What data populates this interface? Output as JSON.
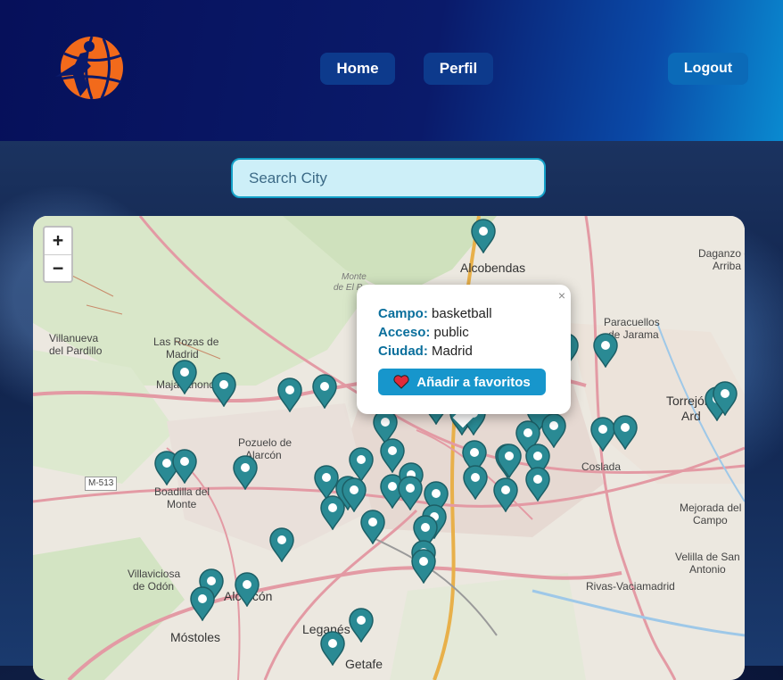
{
  "nav": {
    "home": "Home",
    "perfil": "Perfil",
    "logout": "Logout"
  },
  "search": {
    "placeholder": "Search City"
  },
  "zoom": {
    "in": "+",
    "out": "−"
  },
  "popup": {
    "close": "×",
    "campo_label": "Campo:",
    "campo_value": "basketball",
    "acceso_label": "Acceso:",
    "acceso_value": "public",
    "ciudad_label": "Ciudad:",
    "ciudad_value": "Madrid",
    "fav_button": "Añadir a favoritos"
  },
  "map_labels": {
    "alcobendas": "Alcobendas",
    "monte1": "Monte",
    "monte2": "de El P",
    "dagan1": "Daganzo d",
    "dagan2": "Arriba",
    "paracuellos1": "Paracuellos",
    "paracuellos2": "de Jarama",
    "villanueva1": "Villanueva",
    "villanueva2": "del Pardillo",
    "rozas1": "Las Rozas de",
    "rozas2": "Madrid",
    "majadahonda": "Majadahonda",
    "torrejon1": "Torrejón",
    "torrejon2": "Ard",
    "pozuelo1": "Pozuelo de",
    "pozuelo2": "Alarcón",
    "coslada": "Coslada",
    "boadilla1": "Boadilla del",
    "boadilla2": "Monte",
    "m513": "M-513",
    "mejorada1": "Mejorada del",
    "mejorada2": "Campo",
    "villaviciosa1": "Villaviciosa",
    "villaviciosa2": "de Odón",
    "velilla1": "Velilla de San",
    "velilla2": "Antonio",
    "rivas": "Rivas-Vaciamadrid",
    "alcorcon": "Alcorcón",
    "leganes": "Leganés",
    "mostoles": "Móstoles",
    "getafe": "Getafe"
  },
  "colors": {
    "pin": "#2a8a94",
    "accent": "#1796cc",
    "nav_dark": "#06105a"
  }
}
